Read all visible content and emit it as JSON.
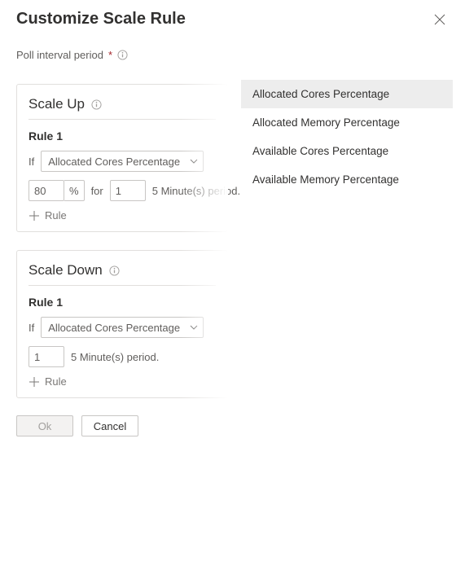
{
  "header": {
    "title": "Customize Scale Rule"
  },
  "poll": {
    "label": "Poll interval period",
    "required_mark": "*"
  },
  "scale_up": {
    "title": "Scale Up",
    "rule_label": "Rule 1",
    "if_label": "If",
    "metric_selected": "Allocated Cores Percentage",
    "threshold": "80",
    "pct_symbol": "%",
    "for_label": "for",
    "duration": "1",
    "period_suffix": "5 Minute(s) period.",
    "add_label": "Rule"
  },
  "scale_down": {
    "title": "Scale Down",
    "rule_label": "Rule 1",
    "if_label": "If",
    "metric_selected": "Allocated Cores Percentage",
    "duration": "1",
    "period_suffix": "5 Minute(s) period.",
    "add_label": "Rule"
  },
  "footer": {
    "ok": "Ok",
    "cancel": "Cancel"
  },
  "dropdown": {
    "items": [
      "Allocated Cores Percentage",
      "Allocated Memory Percentage",
      "Available Cores Percentage",
      "Available Memory Percentage"
    ],
    "selected_index": 0
  }
}
